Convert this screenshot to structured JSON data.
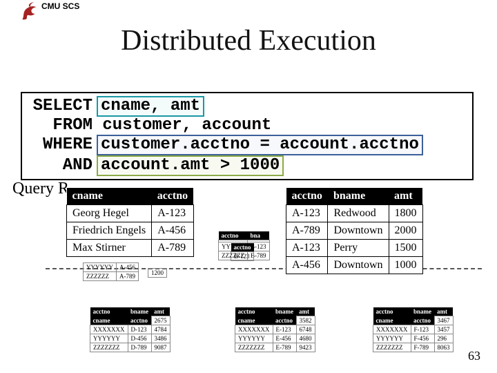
{
  "header": {
    "org": "CMU SCS"
  },
  "title": "Distributed Execution",
  "sql": {
    "kw_select": "SELECT",
    "proj": "cname, amt",
    "kw_from": "FROM",
    "from_clause": " customer, account",
    "kw_where": "WHERE",
    "join": "customer.acctno = account.acctno",
    "kw_and": "AND",
    "filter": "account.amt > 1000"
  },
  "context_label": "Query R",
  "result_left": {
    "cols": [
      "cname",
      "acctno"
    ],
    "rows": [
      [
        "Georg Hegel",
        "A-123"
      ],
      [
        "Friedrich Engels",
        "A-456"
      ],
      [
        "Max Stirner",
        "A-789"
      ]
    ]
  },
  "result_right": {
    "cols": [
      "acctno",
      "bname",
      "amt"
    ],
    "rows": [
      [
        "A-123",
        "Redwood",
        "1800"
      ],
      [
        "A-789",
        "Downtown",
        "2000"
      ],
      [
        "A-123",
        "Perry",
        "1500"
      ],
      [
        "A-456",
        "Downtown",
        "1000"
      ]
    ]
  },
  "bg_small_top_left": {
    "cols": [
      "",
      ""
    ],
    "rows": [
      [
        "YYYYYY",
        "A-456"
      ],
      [
        "ZZZZZZ",
        "A-789"
      ]
    ]
  },
  "bg_small_top_val": {
    "val": "1200"
  },
  "bg_small_top_mid": {
    "cols": [
      "acctno",
      "bna"
    ],
    "rows": [
      [
        "",
        ""
      ],
      [
        "YYYYY",
        "B-123"
      ],
      [
        "ZZZZZZ",
        "B-789"
      ]
    ]
  },
  "bg_small_top_mid2": {
    "cols": [
      "acctno"
    ],
    "rows": [
      [
        "B-123"
      ]
    ]
  },
  "bg_bottom_a": {
    "cols": [
      "acctno",
      "bname",
      "amt"
    ],
    "rows": [
      [
        "cname",
        "acctno",
        "2675"
      ],
      [
        "XXXXXXX",
        "D-123",
        "4784"
      ],
      [
        "YYYYYY",
        "D-456",
        "3486"
      ],
      [
        "ZZZZZZZ",
        "D-789",
        "9087"
      ]
    ]
  },
  "bg_bottom_b": {
    "cols": [
      "acctno",
      "bname",
      "amt"
    ],
    "rows": [
      [
        "cname",
        "acctno",
        "3582"
      ],
      [
        "XXXXXXX",
        "E-123",
        "6748"
      ],
      [
        "YYYYYY",
        "E-456",
        "4680"
      ],
      [
        "ZZZZZZZ",
        "E-789",
        "9423"
      ]
    ]
  },
  "bg_bottom_c": {
    "cols": [
      "acctno",
      "bname",
      "amt"
    ],
    "rows": [
      [
        "cname",
        "acctno",
        "3467"
      ],
      [
        "XXXXXXX",
        "F-123",
        "3457"
      ],
      [
        "YYYYYY",
        "F-456",
        "296"
      ],
      [
        "ZZZZZZZ",
        "F-789",
        "8063"
      ]
    ]
  },
  "slide_number": "63"
}
